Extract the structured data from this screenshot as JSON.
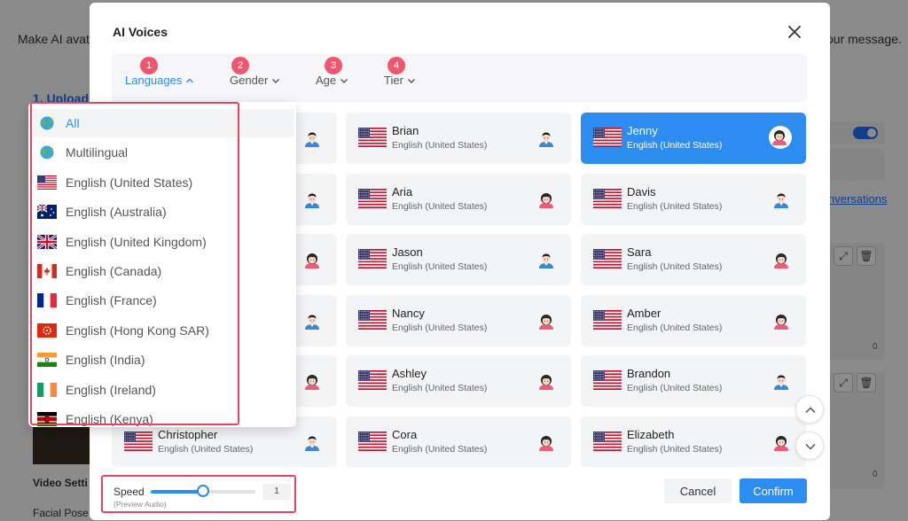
{
  "background": {
    "intro_left": "Make AI avat",
    "intro_right": "our message.",
    "upload_step": "1.  Upload",
    "video_settings": "Video Setti",
    "facial_pose": "Facial Pose",
    "conversations_link": "nversations",
    "char_count_1": "0",
    "char_count_2": "0"
  },
  "modal": {
    "title": "AI Voices",
    "filters": [
      {
        "badge": "1",
        "label": "Languages"
      },
      {
        "badge": "2",
        "label": "Gender"
      },
      {
        "badge": "3",
        "label": "Age"
      },
      {
        "badge": "4",
        "label": "Tier"
      }
    ],
    "voices": [
      {
        "name": "Brian",
        "language": "English (United States)",
        "gender": "male"
      },
      {
        "name": "Jenny",
        "language": "English (United States)",
        "gender": "female"
      },
      {
        "name": "Aria",
        "language": "English (United States)",
        "gender": "female"
      },
      {
        "name": "Davis",
        "language": "English (United States)",
        "gender": "male"
      },
      {
        "name": "Jason",
        "language": "English (United States)",
        "gender": "male"
      },
      {
        "name": "Sara",
        "language": "English (United States)",
        "gender": "female"
      },
      {
        "name": "Nancy",
        "language": "English (United States)",
        "gender": "female"
      },
      {
        "name": "Amber",
        "language": "English (United States)",
        "gender": "female"
      },
      {
        "name": "Ashley",
        "language": "English (United States)",
        "gender": "female"
      },
      {
        "name": "Brandon",
        "language": "English (United States)",
        "gender": "male"
      },
      {
        "name": "Christopher",
        "language": "English (United States)",
        "gender": "male"
      },
      {
        "name": "Cora",
        "language": "English (United States)",
        "gender": "female"
      },
      {
        "name": "Elizabeth",
        "language": "English (United States)",
        "gender": "female"
      }
    ],
    "selected_voice": "Jenny",
    "speed": {
      "label": "Speed",
      "sublabel": "(Preview Audio)",
      "value": "1",
      "fraction": 0.5
    },
    "cancel_label": "Cancel",
    "confirm_label": "Confirm"
  },
  "language_dropdown": {
    "items": [
      {
        "label": "All",
        "icon": "globe-icon"
      },
      {
        "label": "Multilingual",
        "icon": "globe-icon"
      },
      {
        "label": "English (United States)",
        "icon": "flag-us-icon"
      },
      {
        "label": "English (Australia)",
        "icon": "flag-au-icon"
      },
      {
        "label": "English (United Kingdom)",
        "icon": "flag-uk-icon"
      },
      {
        "label": "English (Canada)",
        "icon": "flag-ca-icon"
      },
      {
        "label": "English (France)",
        "icon": "flag-fr-icon"
      },
      {
        "label": "English (Hong Kong SAR)",
        "icon": "flag-hk-icon"
      },
      {
        "label": "English (India)",
        "icon": "flag-in-icon"
      },
      {
        "label": "English (Ireland)",
        "icon": "flag-ie-icon"
      },
      {
        "label": "English (Kenya)",
        "icon": "flag-ke-icon"
      }
    ],
    "selected": "All"
  },
  "colors": {
    "accent": "#2d8cf0",
    "highlight_outline": "#e94560",
    "badge": "#f2566e"
  }
}
